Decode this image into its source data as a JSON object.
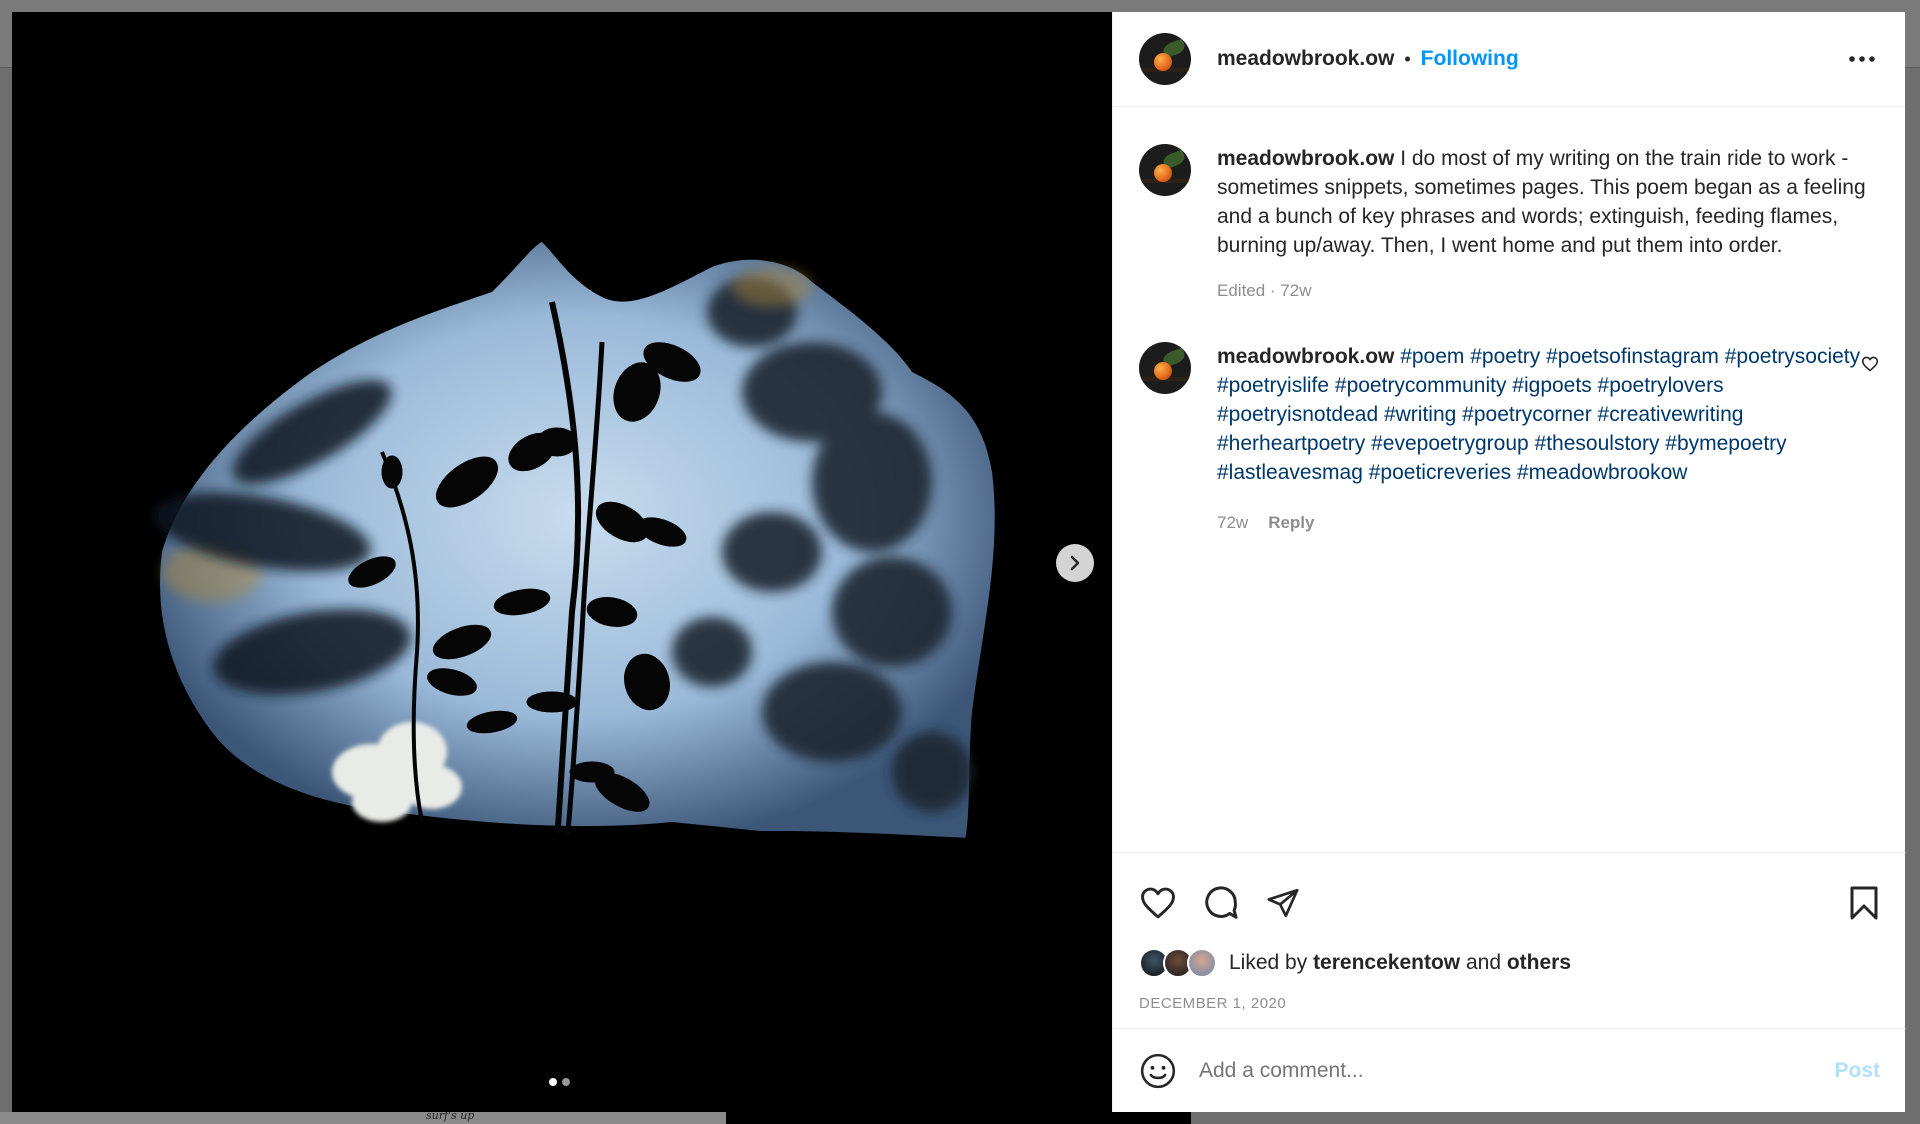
{
  "backdrop": {
    "caption": "surf's up"
  },
  "post": {
    "username": "meadowbrook.ow",
    "separator": "•",
    "follow_status": "Following",
    "caption_text": "I do most of my writing on the train ride to work - sometimes snippets, sometimes pages. This poem began as a feeling and a bunch of key phrases and words; extinguish, feeding flames, burning up/away. Then, I went home and put them into order.",
    "caption_meta": "Edited · 72w",
    "hashtag_comment": {
      "username": "meadowbrook.ow",
      "hashtags": "#poem #poetry #poetsofinstagram #poetrysociety #poetryislife #poetrycommunity #igpoets #poetrylovers #poetryisnotdead #writing #poetrycorner #creativewriting #herheartpoetry #evepoetrygroup #thesoulstory #bymepoetry #lastleavesmag #poeticreveries #meadowbrookow",
      "time": "72w",
      "reply_label": "Reply"
    },
    "liked_prefix": "Liked by",
    "liked_user": "terencekentow",
    "liked_and": "and",
    "liked_others": "others",
    "date": "DECEMBER 1, 2020",
    "comment_placeholder": "Add a comment...",
    "post_button": "Post"
  },
  "media": {
    "slide_count": 2,
    "active_slide": 1
  },
  "icons": {
    "more": "more-horizontal-icon",
    "next": "chevron-right-icon",
    "like": "heart-icon",
    "comment": "comment-icon",
    "share": "send-icon",
    "save": "bookmark-icon",
    "emoji": "emoji-icon"
  },
  "colors": {
    "link": "#0095f6",
    "hashtag": "#00376b",
    "muted": "#8e8e8e",
    "post_disabled": "#b2dffc"
  }
}
